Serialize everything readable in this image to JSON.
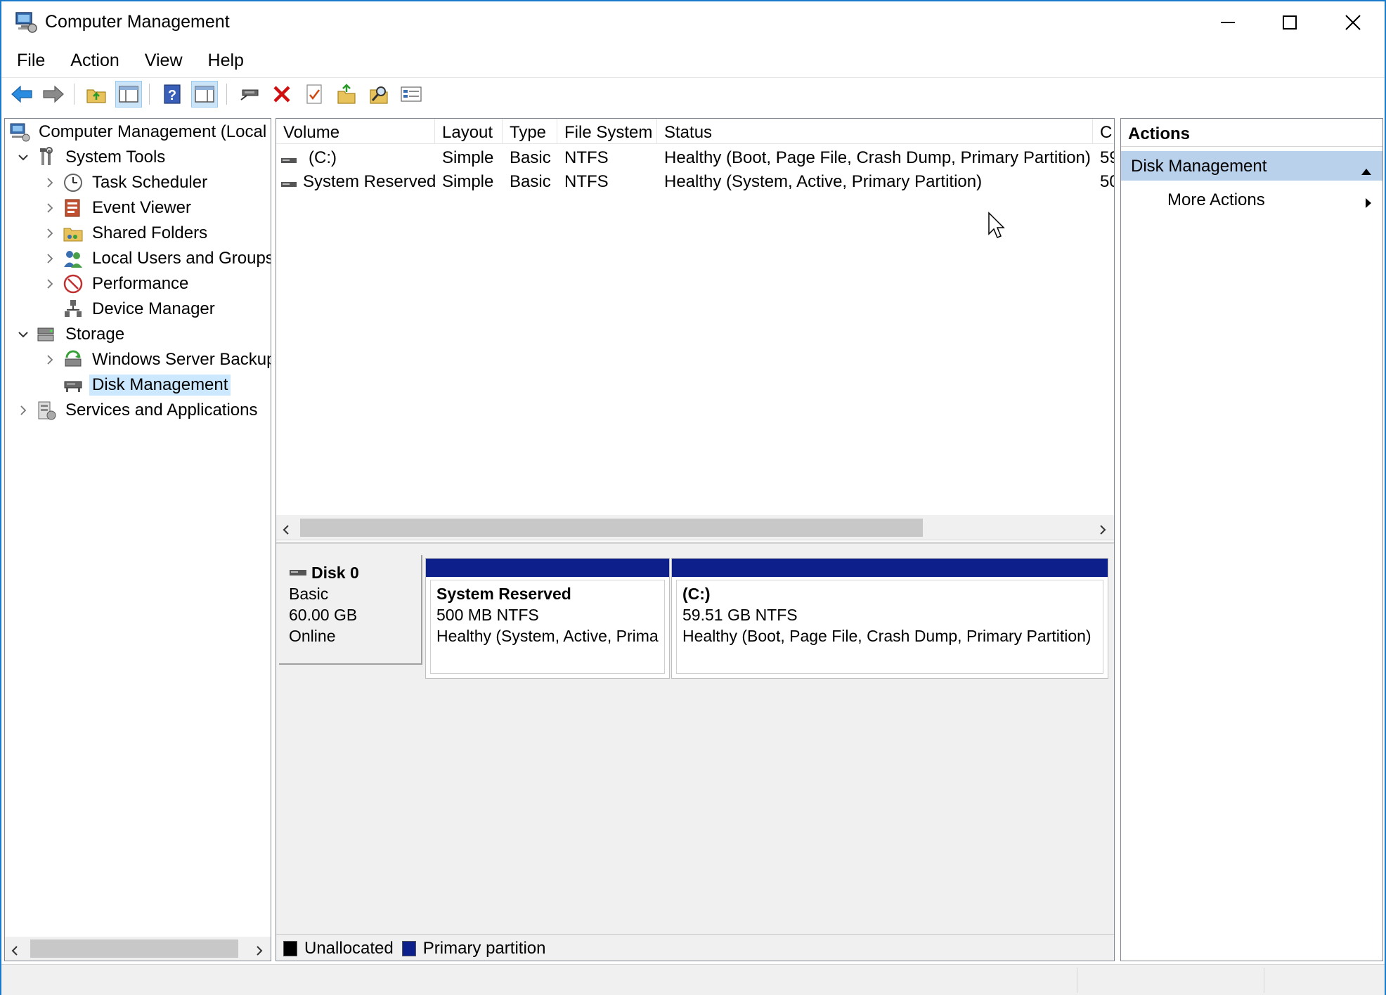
{
  "window": {
    "title": "Computer Management"
  },
  "menu": [
    "File",
    "Action",
    "View",
    "Help"
  ],
  "toolbar": {
    "icons": [
      "back-icon",
      "forward-icon",
      "up-folder-icon",
      "show-hide-tree-icon",
      "help-icon",
      "show-hide-action-pane-icon",
      "connect-icon",
      "delete-icon",
      "properties-icon",
      "export-icon",
      "search-icon",
      "list-view-icon"
    ]
  },
  "tree": {
    "root": "Computer Management (Local",
    "system_tools": "System Tools",
    "task_scheduler": "Task Scheduler",
    "event_viewer": "Event Viewer",
    "shared_folders": "Shared Folders",
    "local_users": "Local Users and Groups",
    "performance": "Performance",
    "device_manager": "Device Manager",
    "storage": "Storage",
    "wsb": "Windows Server Backup",
    "disk_management": "Disk Management",
    "services_apps": "Services and Applications"
  },
  "volume_list": {
    "columns": [
      "Volume",
      "Layout",
      "Type",
      "File System",
      "Status",
      "C"
    ],
    "rows": [
      {
        "volume": "(C:)",
        "layout": "Simple",
        "type": "Basic",
        "fs": "NTFS",
        "status": "Healthy (Boot, Page File, Crash Dump, Primary Partition)",
        "c": "59"
      },
      {
        "volume": "System Reserved",
        "layout": "Simple",
        "type": "Basic",
        "fs": "NTFS",
        "status": "Healthy (System, Active, Primary Partition)",
        "c": "50"
      }
    ]
  },
  "disk": {
    "name": "Disk 0",
    "type": "Basic",
    "size": "60.00 GB",
    "state": "Online",
    "partitions": [
      {
        "name": "System Reserved",
        "size": "500 MB NTFS",
        "status": "Healthy (System, Active, Prima"
      },
      {
        "name": "(C:)",
        "size": "59.51 GB NTFS",
        "status": "Healthy (Boot, Page File, Crash Dump, Primary Partition)"
      }
    ]
  },
  "legend": {
    "unallocated": "Unallocated",
    "primary": "Primary partition",
    "unallocated_color": "#000000",
    "primary_color": "#0d1f8a"
  },
  "actions": {
    "title": "Actions",
    "section": "Disk Management",
    "more": "More Actions"
  }
}
